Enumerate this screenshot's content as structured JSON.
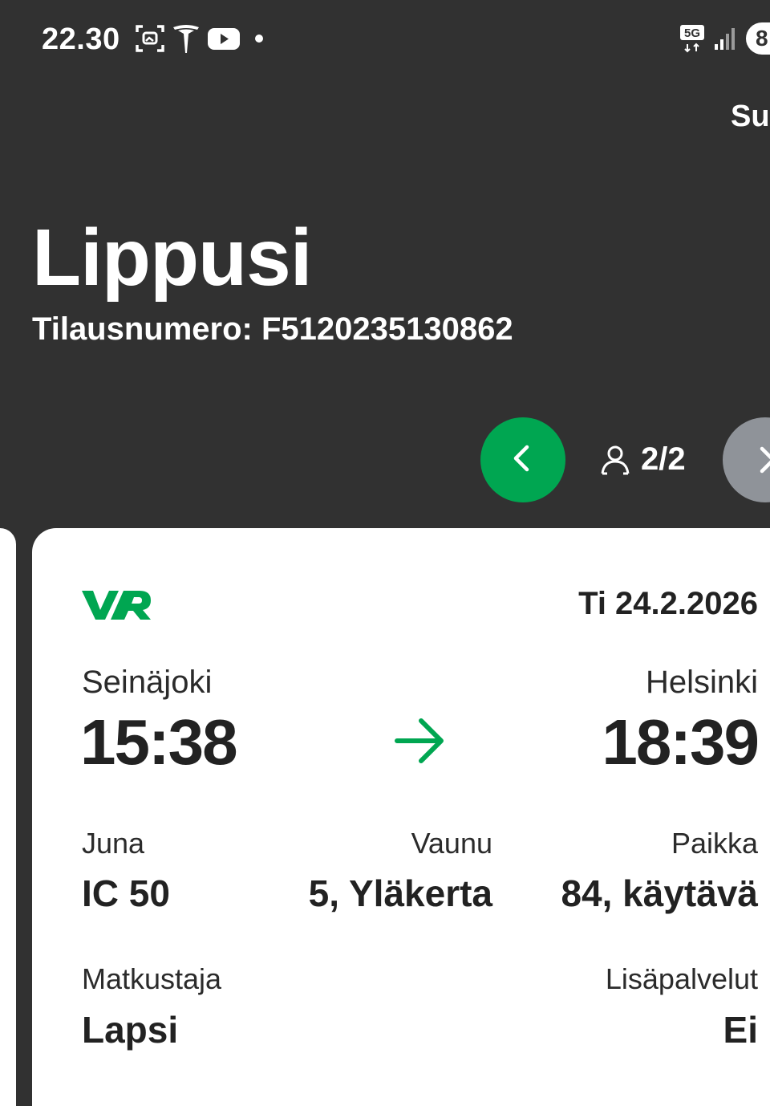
{
  "status_bar": {
    "time": "22.30",
    "network": "5G",
    "battery": "8",
    "icons": [
      "screenshot-icon",
      "tesla-icon",
      "youtube-icon",
      "notification-dot",
      "5g-icon",
      "signal-icon",
      "battery-icon"
    ]
  },
  "header": {
    "action_label": "Su",
    "title": "Lippusi",
    "order_line": "Tilausnumero: F5120235130862"
  },
  "pager": {
    "count": "2/2",
    "prev_icon": "chevron-left-icon",
    "next_icon": "chevron-right-icon",
    "person_icon": "person-icon"
  },
  "ticket": {
    "brand": "VR",
    "date": "Ti 24.2.2026",
    "from_station": "Seinäjoki",
    "to_station": "Helsinki",
    "departure_time": "15:38",
    "arrival_time": "18:39",
    "train_label": "Juna",
    "train_value": "IC 50",
    "car_label": "Vaunu",
    "car_value": "5, Yläkerta",
    "seat_label": "Paikka",
    "seat_value": "84, käytävä",
    "traveller_label": "Matkustaja",
    "traveller_value": "Lapsi",
    "extras_label": "Lisäpalvelut",
    "extras_value": "Ei"
  },
  "colors": {
    "background": "#313131",
    "accent_green": "#00a651",
    "disabled_grey": "#8f9399",
    "card": "#ffffff"
  }
}
